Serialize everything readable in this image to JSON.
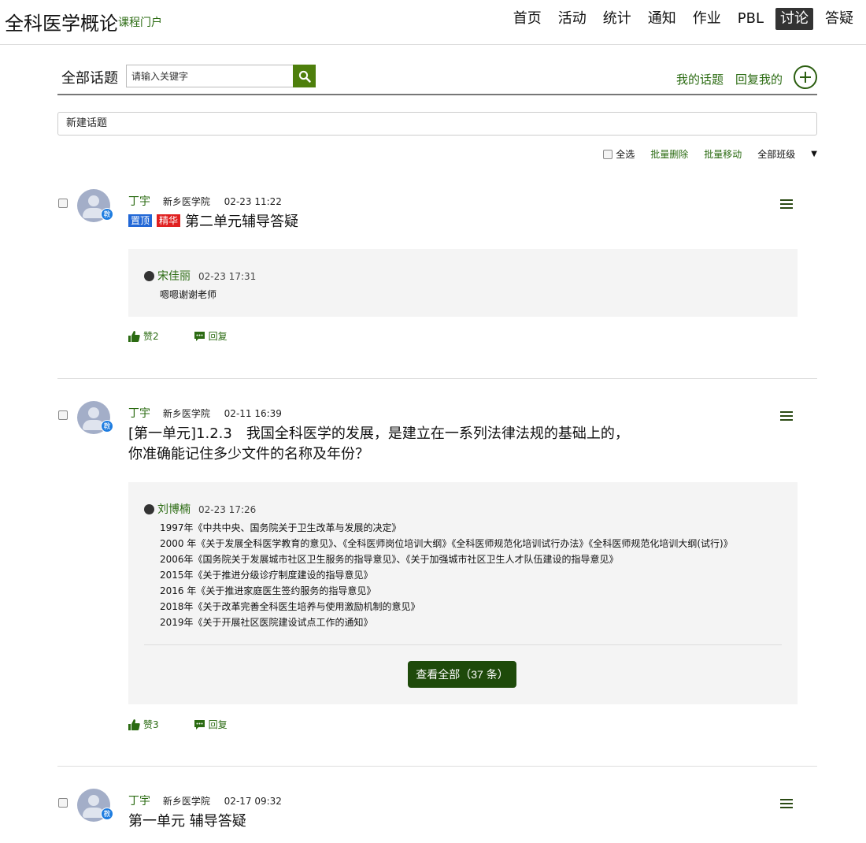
{
  "header": {
    "course_title": "全科医学概论",
    "portal_link": "课程门户",
    "nav": [
      {
        "label": "首页",
        "active": false
      },
      {
        "label": "活动",
        "active": false
      },
      {
        "label": "统计",
        "active": false
      },
      {
        "label": "通知",
        "active": false
      },
      {
        "label": "作业",
        "active": false
      },
      {
        "label": "PBL",
        "active": false
      },
      {
        "label": "讨论",
        "active": true
      },
      {
        "label": "答疑",
        "active": false
      }
    ]
  },
  "topics": {
    "all_topics": "全部话题",
    "search_placeholder": "请输入关键字",
    "my_topics": "我的话题",
    "replies_to_me": "回复我的",
    "new_topic": "新建话题"
  },
  "toolbar": {
    "select_all": "全选",
    "batch_delete": "批量删除",
    "batch_move": "批量移动",
    "class_filter": "全部班级"
  },
  "posts": [
    {
      "author": "丁宇",
      "school": "新乡医学院",
      "time": "02-23 11:22",
      "role_badge": "教",
      "tags": [
        "置顶",
        "精华"
      ],
      "title": "第二单元辅导答疑",
      "reply": {
        "author": "宋佳丽",
        "time": "02-23 17:31",
        "lines": [
          "嗯嗯谢谢老师"
        ]
      },
      "likes": "赞2",
      "reply_label": "回复"
    },
    {
      "author": "丁宇",
      "school": "新乡医学院",
      "time": "02-11 16:39",
      "role_badge": "教",
      "title_line1": "[第一单元]1.2.3　我国全科医学的发展，是建立在一系列法律法规的基础上的，",
      "title_line2": "你准确能记住多少文件的名称及年份？",
      "reply": {
        "author": "刘博楠",
        "time": "02-23 17:26",
        "lines": [
          "1997年《中共中央、国务院关于卫生改革与发展的决定》",
          "2000 年《关于发展全科医学教育的意见》、《全科医师岗位培训大纲》《全科医师规范化培训试行办法》《全科医师规范化培训大纲(试行)》",
          "2006年《国务院关于发展城市社区卫生服务的指导意见》、《关于加强城市社区卫生人才队伍建设的指导意见》",
          "2015年《关于推进分级诊疗制度建设的指导意见》",
          "2016 年《关于推进家庭医生签约服务的指导意见》",
          "2018年《关于改革完善全科医生培养与使用激励机制的意见》",
          "2019年《关于开展社区医院建设试点工作的通知》"
        ]
      },
      "view_all": "查看全部（37 条）",
      "likes": "赞3",
      "reply_label": "回复"
    },
    {
      "author": "丁宇",
      "school": "新乡医学院",
      "time": "02-17 09:32",
      "role_badge": "教",
      "title": "第一单元  辅导答疑"
    }
  ],
  "colors": {
    "accent_green": "#2b6b12",
    "search_button": "#4e7f0c",
    "view_all_button": "#1e4a0a",
    "tag_top": "#2167d6",
    "tag_best": "#e02020",
    "teacher_badge": "#1d7ce0"
  }
}
